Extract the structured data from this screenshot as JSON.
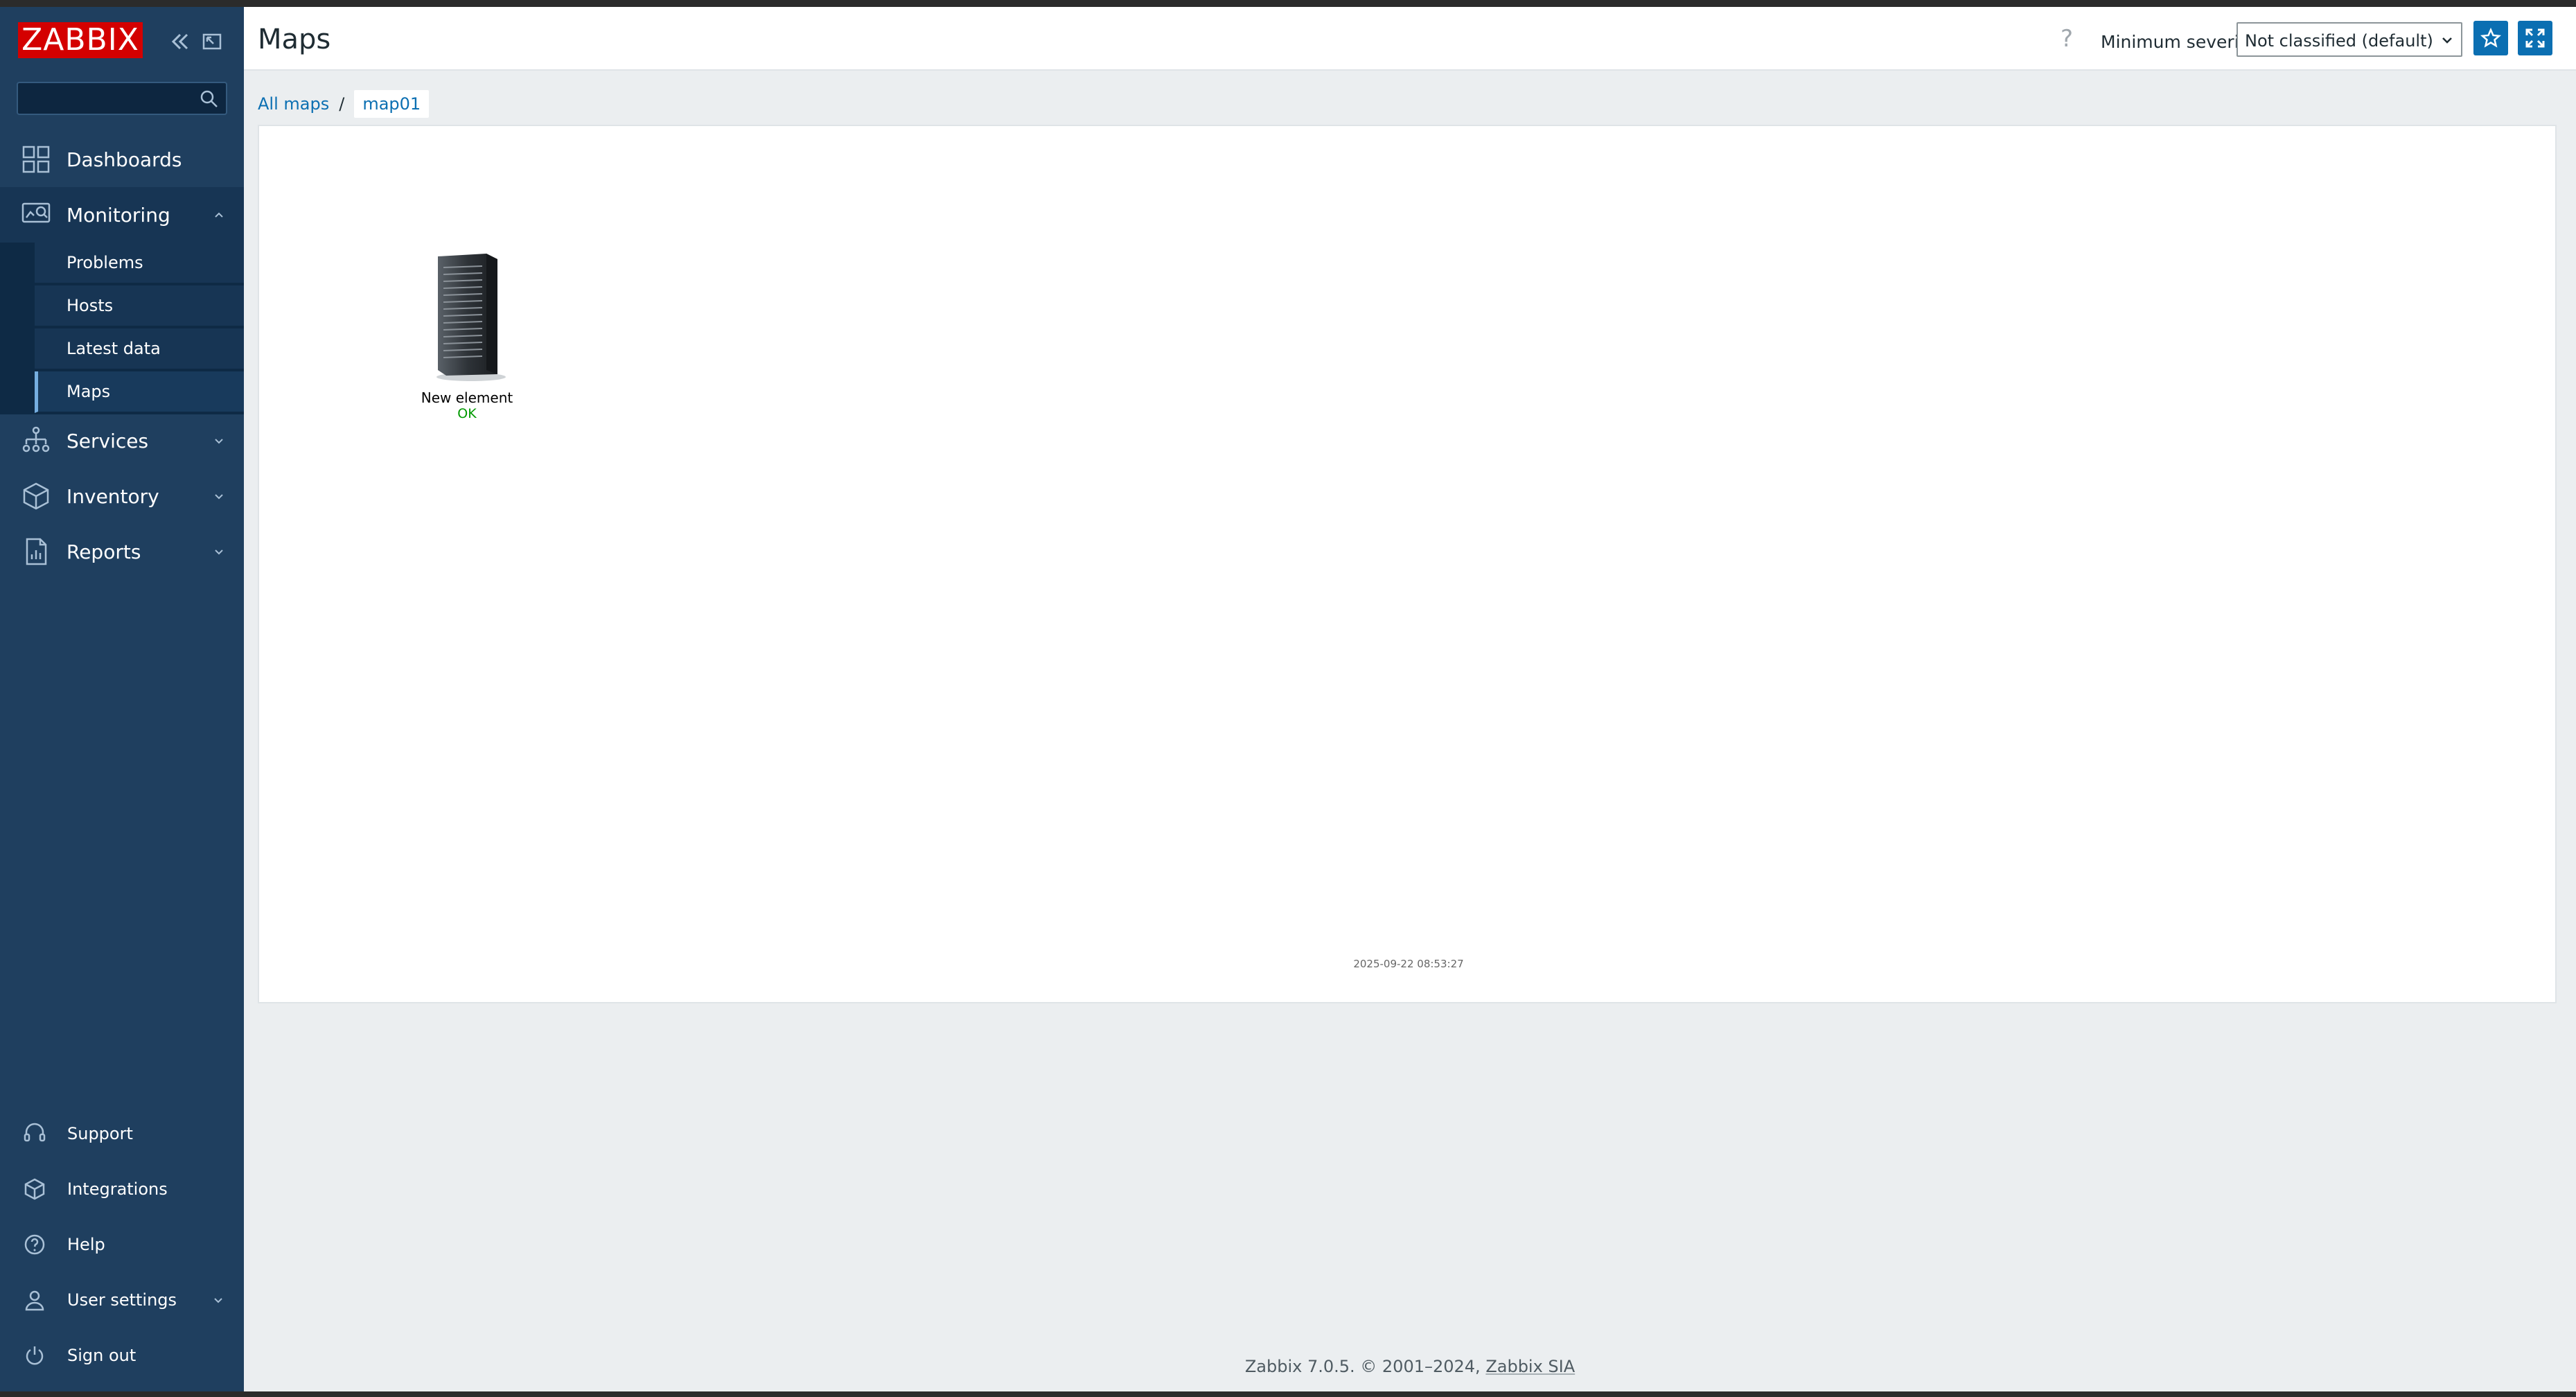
{
  "sidebar": {
    "logo": "ZABBIX",
    "search": {
      "placeholder": "",
      "value": ""
    },
    "menu": [
      {
        "label": "Dashboards"
      },
      {
        "label": "Monitoring",
        "expanded": true,
        "children": [
          {
            "label": "Problems"
          },
          {
            "label": "Hosts"
          },
          {
            "label": "Latest data"
          },
          {
            "label": "Maps",
            "active": true
          }
        ]
      },
      {
        "label": "Services"
      },
      {
        "label": "Inventory"
      },
      {
        "label": "Reports"
      }
    ],
    "bottom": [
      {
        "label": "Support"
      },
      {
        "label": "Integrations"
      },
      {
        "label": "Help"
      },
      {
        "label": "User settings"
      },
      {
        "label": "Sign out"
      }
    ]
  },
  "header": {
    "title": "Maps",
    "help": "?",
    "severity_label": "Minimum severity",
    "severity_value": "Not classified (default)"
  },
  "breadcrumb": {
    "root": "All maps",
    "separator": "/",
    "current": "map01"
  },
  "map": {
    "element_name": "New element",
    "element_status": "OK",
    "timestamp": "2025-09-22 08:53:27"
  },
  "footer": {
    "text": "Zabbix 7.0.5. © 2001–2024, ",
    "link": "Zabbix SIA"
  },
  "colors": {
    "sidebar": "#1f3f5f",
    "accent": "#0b6fb2",
    "logo": "#d40000",
    "ok": "#009900"
  }
}
